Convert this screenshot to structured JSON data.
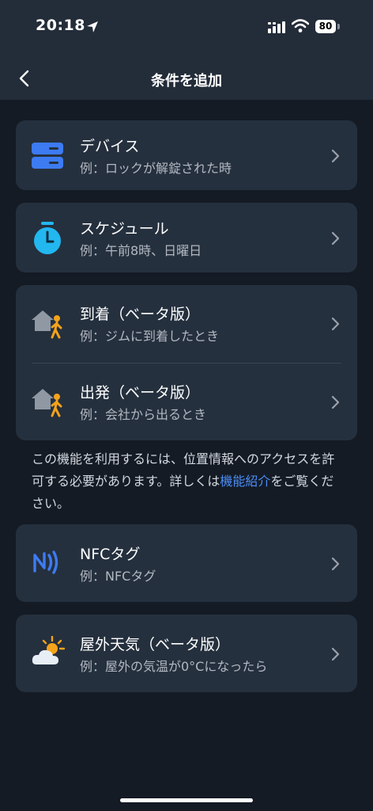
{
  "status_bar": {
    "time": "20:18",
    "battery": "80"
  },
  "header": {
    "title": "条件を追加",
    "back_icon": "chevron-left-icon"
  },
  "conditions": [
    {
      "icon": "device-icon",
      "title": "デバイス",
      "example": "例：ロックが解錠された時"
    },
    {
      "icon": "timer-icon",
      "title": "スケジュール",
      "example": "例：午前8時、日曜日"
    },
    {
      "icon": "arrive-home-icon",
      "title": "到着（ベータ版）",
      "example": "例：ジムに到着したとき"
    },
    {
      "icon": "leave-home-icon",
      "title": "出発（ベータ版）",
      "example": "例：会社から出るとき"
    },
    {
      "icon": "nfc-icon",
      "title": "NFCタグ",
      "example": "例：NFCタグ"
    },
    {
      "icon": "weather-icon",
      "title": "屋外天気（ベータ版）",
      "example": "例：屋外の気温が0°Cになったら"
    }
  ],
  "location_note": {
    "text": "この機能を利用するには、位置情報へのアクセスを許可する必要があります。詳しくは",
    "link": "機能紹介",
    "suffix": "をご覧ください。"
  },
  "colors": {
    "background": "#141b25",
    "card": "#25303e",
    "accent_blue": "#3d7bf2",
    "timer_cyan": "#23b7f0",
    "person_orange": "#f5a31a",
    "link": "#4c8cf5"
  }
}
